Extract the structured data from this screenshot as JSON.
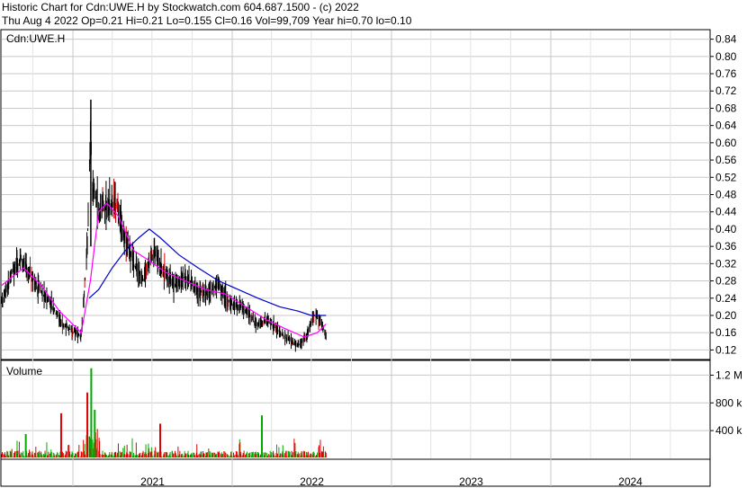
{
  "header": {
    "line1": "Historic Chart for Cdn:UWE.H by Stockwatch.com 604.687.1500 - (c) 2022",
    "line2": "Thu Aug  4 2022  Op=0.21  Hi=0.21  Lo=0.155  Cl=0.16  Vol=99,709  Year hi=0.70  lo=0.10"
  },
  "colors": {
    "price_bar": "#000000",
    "down_tick": "#cc0000",
    "ma_short": "#ff00ff",
    "ma_long": "#0000cc",
    "volume_up": "#00aa00",
    "volume_down": "#dd0000",
    "grid": "#c8c8c8"
  },
  "chart_data": [
    {
      "type": "ohlc",
      "panel": "price",
      "label": "Cdn:UWE.H",
      "y_ticks": [
        "0.84",
        "0.80",
        "0.76",
        "0.72",
        "0.68",
        "0.64",
        "0.60",
        "0.56",
        "0.52",
        "0.48",
        "0.44",
        "0.40",
        "0.36",
        "0.32",
        "0.28",
        "0.24",
        "0.20",
        "0.16",
        "0.12"
      ],
      "y_range": [
        0.1,
        0.86
      ],
      "grid": true,
      "x_range": [
        "2020-07-22",
        "2024-12-31"
      ],
      "keypoints": [
        {
          "date": "2020-07-22",
          "close": 0.23
        },
        {
          "date": "2020-08-15",
          "close": 0.3
        },
        {
          "date": "2020-09-05",
          "close": 0.33
        },
        {
          "date": "2020-10-10",
          "close": 0.27
        },
        {
          "date": "2020-11-15",
          "close": 0.22
        },
        {
          "date": "2020-12-10",
          "close": 0.18
        },
        {
          "date": "2021-01-05",
          "close": 0.16
        },
        {
          "date": "2021-01-20",
          "close": 0.15
        },
        {
          "date": "2021-02-03",
          "close": 0.36
        },
        {
          "date": "2021-02-10",
          "close": 0.62
        },
        {
          "date": "2021-02-15",
          "close": 0.5
        },
        {
          "date": "2021-03-01",
          "close": 0.44
        },
        {
          "date": "2021-03-20",
          "close": 0.45
        },
        {
          "date": "2021-04-10",
          "close": 0.46
        },
        {
          "date": "2021-05-01",
          "close": 0.38
        },
        {
          "date": "2021-05-20",
          "close": 0.32
        },
        {
          "date": "2021-06-10",
          "close": 0.28
        },
        {
          "date": "2021-07-05",
          "close": 0.35
        },
        {
          "date": "2021-07-25",
          "close": 0.31
        },
        {
          "date": "2021-08-20",
          "close": 0.27
        },
        {
          "date": "2021-09-15",
          "close": 0.29
        },
        {
          "date": "2021-10-10",
          "close": 0.26
        },
        {
          "date": "2021-11-05",
          "close": 0.25
        },
        {
          "date": "2021-12-01",
          "close": 0.27
        },
        {
          "date": "2021-12-25",
          "close": 0.23
        },
        {
          "date": "2022-01-25",
          "close": 0.22
        },
        {
          "date": "2022-02-25",
          "close": 0.18
        },
        {
          "date": "2022-03-25",
          "close": 0.19
        },
        {
          "date": "2022-05-01",
          "close": 0.15
        },
        {
          "date": "2022-06-01",
          "close": 0.13
        },
        {
          "date": "2022-06-20",
          "close": 0.15
        },
        {
          "date": "2022-07-05",
          "close": 0.2
        },
        {
          "date": "2022-07-20",
          "close": 0.19
        },
        {
          "date": "2022-08-04",
          "close": 0.16
        }
      ],
      "moving_averages": [
        {
          "color": "#ff00ff",
          "keypoints": [
            {
              "date": "2020-07-22",
              "value": 0.27
            },
            {
              "date": "2020-09-10",
              "value": 0.31
            },
            {
              "date": "2020-10-20",
              "value": 0.27
            },
            {
              "date": "2020-12-01",
              "value": 0.21
            },
            {
              "date": "2021-01-20",
              "value": 0.16
            },
            {
              "date": "2021-02-10",
              "value": 0.28
            },
            {
              "date": "2021-03-01",
              "value": 0.44
            },
            {
              "date": "2021-03-20",
              "value": 0.46
            },
            {
              "date": "2021-04-15",
              "value": 0.43
            },
            {
              "date": "2021-05-20",
              "value": 0.35
            },
            {
              "date": "2021-06-20",
              "value": 0.33
            },
            {
              "date": "2021-08-01",
              "value": 0.3
            },
            {
              "date": "2021-09-15",
              "value": 0.28
            },
            {
              "date": "2021-11-01",
              "value": 0.26
            },
            {
              "date": "2021-12-15",
              "value": 0.25
            },
            {
              "date": "2022-02-01",
              "value": 0.22
            },
            {
              "date": "2022-03-20",
              "value": 0.19
            },
            {
              "date": "2022-05-01",
              "value": 0.17
            },
            {
              "date": "2022-06-15",
              "value": 0.15
            },
            {
              "date": "2022-07-15",
              "value": 0.16
            },
            {
              "date": "2022-08-04",
              "value": 0.18
            }
          ]
        },
        {
          "color": "#0000cc",
          "keypoints": [
            {
              "date": "2021-02-07",
              "value": 0.24
            },
            {
              "date": "2021-03-01",
              "value": 0.26
            },
            {
              "date": "2021-04-01",
              "value": 0.31
            },
            {
              "date": "2021-05-01",
              "value": 0.35
            },
            {
              "date": "2021-06-01",
              "value": 0.38
            },
            {
              "date": "2021-06-25",
              "value": 0.4
            },
            {
              "date": "2021-07-20",
              "value": 0.38
            },
            {
              "date": "2021-09-01",
              "value": 0.34
            },
            {
              "date": "2021-10-15",
              "value": 0.31
            },
            {
              "date": "2021-12-01",
              "value": 0.28
            },
            {
              "date": "2022-01-15",
              "value": 0.26
            },
            {
              "date": "2022-03-01",
              "value": 0.24
            },
            {
              "date": "2022-04-20",
              "value": 0.22
            },
            {
              "date": "2022-06-01",
              "value": 0.21
            },
            {
              "date": "2022-07-01",
              "value": 0.2
            },
            {
              "date": "2022-08-04",
              "value": 0.2
            }
          ]
        }
      ]
    },
    {
      "type": "bar",
      "panel": "volume",
      "label": "Volume",
      "y_ticks": [
        "1.2 M",
        "800 k",
        "400 k"
      ],
      "y_range": [
        0,
        1400000
      ],
      "notable_bars": [
        {
          "date": "2021-02-12",
          "value": 1300000
        },
        {
          "date": "2021-02-03",
          "value": 950000
        },
        {
          "date": "2021-02-20",
          "value": 700000
        },
        {
          "date": "2020-12-05",
          "value": 650000
        },
        {
          "date": "2022-03-10",
          "value": 620000
        },
        {
          "date": "2021-07-20",
          "value": 500000
        },
        {
          "date": "2020-09-15",
          "value": 350000
        }
      ]
    }
  ],
  "x_axis": {
    "labels": [
      "2021",
      "2022",
      "2023",
      "2024"
    ]
  }
}
